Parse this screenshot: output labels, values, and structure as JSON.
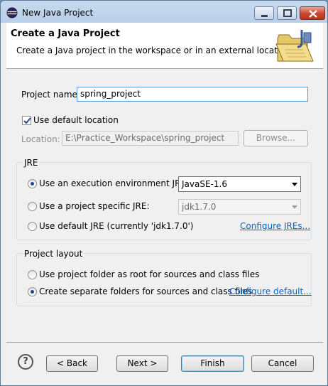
{
  "window": {
    "title": "New Java Project",
    "icon": "eclipse-icon"
  },
  "banner": {
    "title": "Create a Java Project",
    "description": "Create a Java project in the workspace or in an external location.",
    "image": "java-project-folder-icon"
  },
  "project": {
    "name_label": "Project name:",
    "name_value": "spring_project"
  },
  "location": {
    "use_default_label": "Use default location",
    "use_default_checked": true,
    "location_label": "Location:",
    "location_value": "E:\\Practice_Workspace\\spring_project",
    "browse_label": "Browse..."
  },
  "jre": {
    "group_label": "JRE",
    "options": [
      {
        "label": "Use an execution environment JRE:",
        "checked": true
      },
      {
        "label": "Use a project specific JRE:",
        "checked": false
      },
      {
        "label": "Use default JRE (currently 'jdk1.7.0')",
        "checked": false
      }
    ],
    "execution_env_selected": "JavaSE-1.6",
    "project_specific_selected": "jdk1.7.0",
    "configure_link": "Configure JREs..."
  },
  "layout": {
    "group_label": "Project layout",
    "options": [
      {
        "label": "Use project folder as root for sources and class files",
        "checked": false
      },
      {
        "label": "Create separate folders for sources and class files",
        "checked": true
      }
    ],
    "configure_link": "Configure default..."
  },
  "footer": {
    "help": "?",
    "back_label": "< Back",
    "next_label": "Next >",
    "finish_label": "Finish",
    "cancel_label": "Cancel"
  }
}
